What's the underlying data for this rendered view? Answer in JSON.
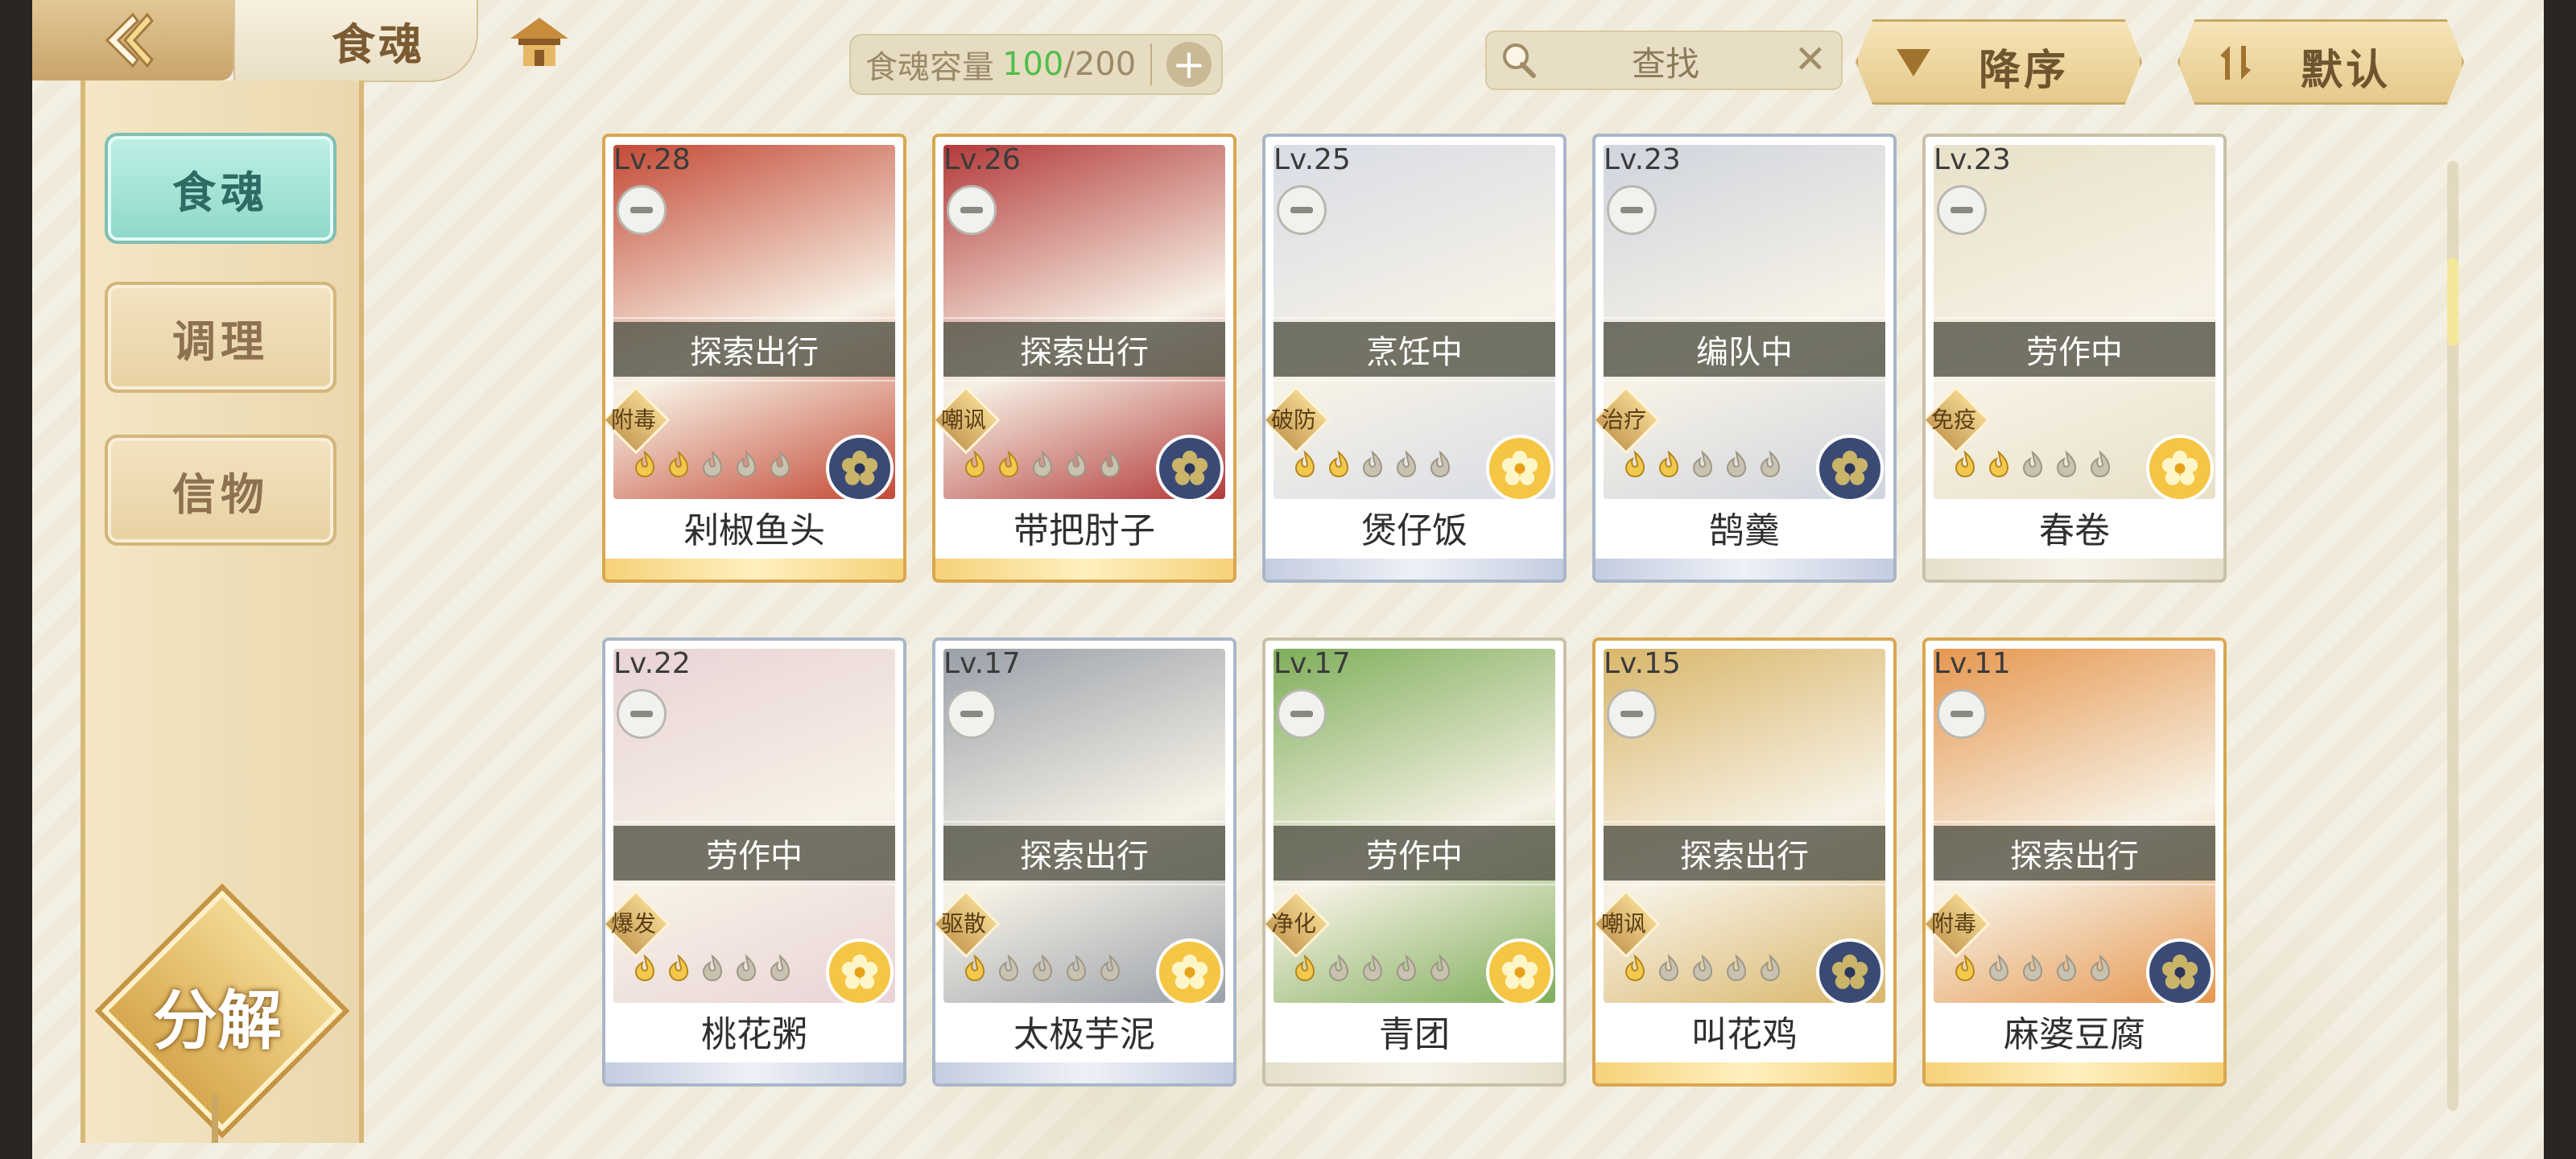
{
  "header": {
    "title": "食魂",
    "capacity_label": "食魂容量",
    "capacity_current": "100",
    "capacity_max": "/200",
    "search_text": "查找",
    "sort_order": "降序",
    "sort_mode": "默认"
  },
  "nav": {
    "items": [
      {
        "label": "食魂",
        "active": true
      },
      {
        "label": "调理",
        "active": false
      },
      {
        "label": "信物",
        "active": false
      }
    ],
    "decompose": "分解"
  },
  "colors": {
    "accent_gold": "#d9a750",
    "active_teal": "#8fd8c9",
    "capacity_green": "#4fbf4a"
  },
  "cards": [
    {
      "level": "Lv.28",
      "status": "探索出行",
      "skill": "附毒",
      "name": "剁椒鱼头",
      "stars": 2,
      "element": "navy",
      "frame": "gold",
      "art": "#c44a36"
    },
    {
      "level": "Lv.26",
      "status": "探索出行",
      "skill": "嘲讽",
      "name": "带把肘子",
      "stars": 2,
      "element": "navy",
      "frame": "gold",
      "art": "#b33a3a"
    },
    {
      "level": "Lv.25",
      "status": "烹饪中",
      "skill": "破防",
      "name": "煲仔饭",
      "stars": 2,
      "element": "gold",
      "frame": "blue",
      "art": "#d8dce6"
    },
    {
      "level": "Lv.23",
      "status": "编队中",
      "skill": "治疗",
      "name": "鹄羹",
      "stars": 2,
      "element": "navy",
      "frame": "blue",
      "art": "#cfd4de"
    },
    {
      "level": "Lv.23",
      "status": "劳作中",
      "skill": "免疫",
      "name": "春卷",
      "stars": 2,
      "element": "gold",
      "frame": "plain",
      "art": "#e8e0c8"
    },
    {
      "level": "Lv.22",
      "status": "劳作中",
      "skill": "爆发",
      "name": "桃花粥",
      "stars": 2,
      "element": "gold",
      "frame": "blue",
      "art": "#e9d3d6"
    },
    {
      "level": "Lv.17",
      "status": "探索出行",
      "skill": "驱散",
      "name": "太极芋泥",
      "stars": 1,
      "element": "gold",
      "frame": "blue",
      "art": "#9aa0aa"
    },
    {
      "level": "Lv.17",
      "status": "劳作中",
      "skill": "净化",
      "name": "青团",
      "stars": 1,
      "element": "gold",
      "frame": "plain",
      "art": "#7fae5a"
    },
    {
      "level": "Lv.15",
      "status": "探索出行",
      "skill": "嘲讽",
      "name": "叫花鸡",
      "stars": 1,
      "element": "navy",
      "frame": "gold",
      "art": "#d9b66a"
    },
    {
      "level": "Lv.11",
      "status": "探索出行",
      "skill": "附毒",
      "name": "麻婆豆腐",
      "stars": 1,
      "element": "navy",
      "frame": "gold",
      "art": "#e6974f"
    }
  ]
}
